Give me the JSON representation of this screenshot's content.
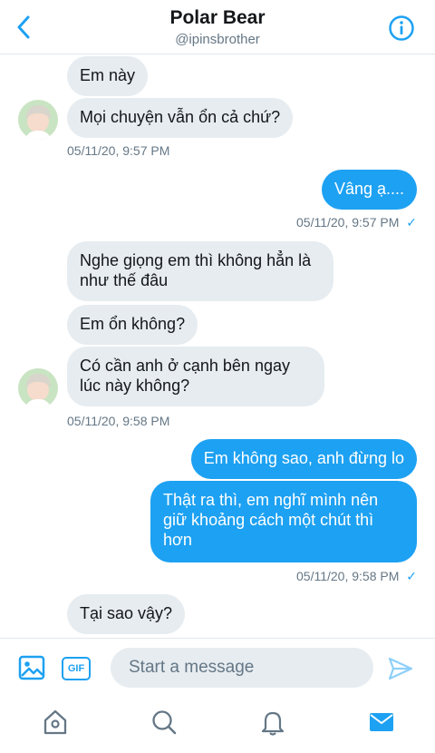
{
  "header": {
    "title": "Polar Bear",
    "handle": "@ipinsbrother"
  },
  "messages": {
    "m1": "Em này",
    "m2": "Mọi chuyện vẫn ổn cả chứ?",
    "t1": "05/11/20, 9:57 PM",
    "m3": "Vâng ạ....",
    "t2": "05/11/20, 9:57 PM",
    "m4": "Nghe giọng em thì không hẳn là như thế đâu",
    "m5": "Em ổn không?",
    "m6": "Có cần anh ở cạnh bên ngay lúc này không?",
    "t3": "05/11/20, 9:58 PM",
    "m7": "Em không sao, anh đừng lo",
    "m8": "Thật ra thì, em nghĩ mình nên giữ khoảng cách một chút thì hơn",
    "t4": "05/11/20, 9:58 PM",
    "m9": "Tại sao vậy?",
    "check": "✓"
  },
  "composer": {
    "gif_label": "GIF",
    "placeholder": "Start a message"
  },
  "colors": {
    "accent": "#1da1f2",
    "incoming_bubble": "#e6ecf0"
  },
  "icons": {
    "back": "chevron-left-icon",
    "info": "info-icon",
    "image": "image-icon",
    "send": "send-icon",
    "home": "home-icon",
    "search": "search-icon",
    "notifications": "bell-icon",
    "messages": "mail-icon"
  }
}
